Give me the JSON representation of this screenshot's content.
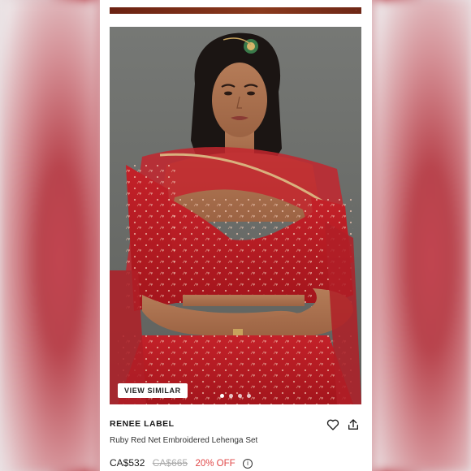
{
  "listing": {
    "view_similar_label": "VIEW SIMILAR",
    "brand": "RENEE LABEL",
    "title": "Ruby Red Net Embroidered Lehenga Set",
    "price": "CA$532",
    "original_price": "CA$665",
    "discount": "20% OFF",
    "info_icon_glyph": "i",
    "carousel": {
      "total": 4,
      "active_index": 0
    }
  },
  "icons": {
    "like": "heart-icon",
    "share": "share-icon",
    "info": "info-icon"
  },
  "colors": {
    "discount": "#e04848",
    "strikethrough": "#aaaaaa",
    "text": "#1a1a1a",
    "garment": "#b81e24"
  }
}
